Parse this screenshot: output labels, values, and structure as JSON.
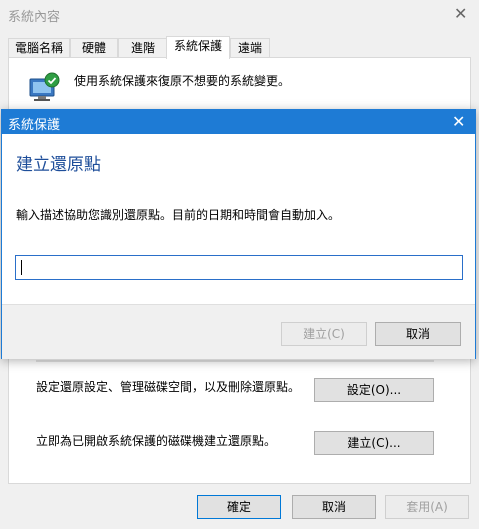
{
  "window": {
    "title": "系統內容",
    "close_glyph": "✕"
  },
  "tabs": [
    {
      "label": "電腦名稱"
    },
    {
      "label": "硬體"
    },
    {
      "label": "進階"
    },
    {
      "label": "系統保護",
      "active": true
    },
    {
      "label": "遠端"
    }
  ],
  "protection": {
    "intro": "使用系統保護來復原不想要的系統變更。",
    "configure_text": "設定還原設定、管理磁碟空間，以及刪除還原點。",
    "configure_button": "設定(O)...",
    "create_text": "立即為已開啟系統保護的磁碟機建立還原點。",
    "create_button": "建立(C)..."
  },
  "footer": {
    "ok": "確定",
    "cancel": "取消",
    "apply": "套用(A)"
  },
  "dialog": {
    "title": "系統保護",
    "close_glyph": "✕",
    "heading": "建立還原點",
    "description": "輸入描述協助您識別還原點。目前的日期和時間會自動加入。",
    "input_value": "",
    "create_button": "建立(C)",
    "cancel_button": "取消"
  },
  "colors": {
    "accent": "#1e7bd5",
    "heading": "#1e4e9a"
  }
}
